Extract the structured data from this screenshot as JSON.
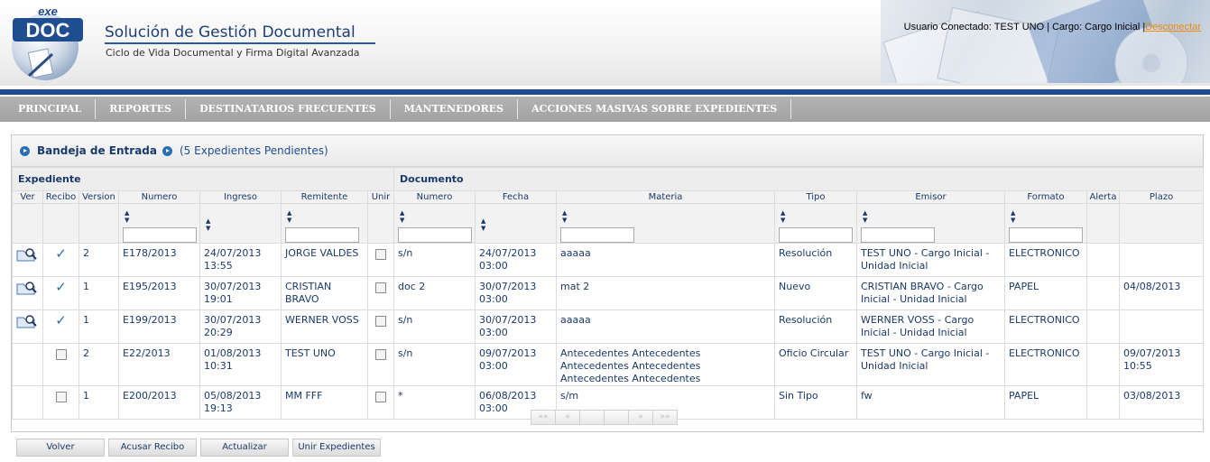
{
  "header": {
    "logo_text": "exe DOC",
    "title": "Solución de Gestión Documental",
    "subtitle": "Ciclo de Vida Documental y Firma Digital Avanzada",
    "user_info": "Usuario Conectado: TEST UNO | Cargo: Cargo Inicial |",
    "logout_label": "Desconectar",
    "accent_color": "#1f4e90",
    "link_color": "#f08a00"
  },
  "nav": {
    "items": [
      "PRINCIPAL",
      "REPORTES",
      "DESTINATARIOS FRECUENTES",
      "MANTENEDORES",
      "ACCIONES MASIVAS SOBRE EXPEDIENTES"
    ]
  },
  "inbox": {
    "title": "Bandeja de Entrada",
    "count_text": "(5 Expedientes Pendientes)",
    "group_expediente": "Expediente",
    "group_documento": "Documento",
    "columns": [
      "Ver",
      "Recibo",
      "Version",
      "Numero",
      "Ingreso",
      "Remitente",
      "Unir",
      "Numero",
      "Fecha",
      "Materia",
      "Tipo",
      "Emisor",
      "Formato",
      "Alerta",
      "Plazo"
    ],
    "rows": [
      {
        "recibo": "checked",
        "version": "2",
        "numero": "E178/2013",
        "ingreso": "24/07/2013 13:55",
        "remitente": "JORGE VALDES",
        "doc_numero": "s/n",
        "fecha": "24/07/2013 03:00",
        "materia": "aaaaa",
        "tipo": "Resolución",
        "emisor": "TEST UNO - Cargo Inicial - Unidad Inicial",
        "formato": "ELECTRONICO",
        "alerta": "",
        "plazo": ""
      },
      {
        "recibo": "checked",
        "version": "1",
        "numero": "E195/2013",
        "ingreso": "30/07/2013 19:01",
        "remitente": "CRISTIAN BRAVO",
        "doc_numero": "doc 2",
        "fecha": "30/07/2013 03:00",
        "materia": "mat 2",
        "tipo": "Nuevo",
        "emisor": "CRISTIAN BRAVO - Cargo Inicial - Unidad Inicial",
        "formato": "PAPEL",
        "alerta": "",
        "plazo": "04/08/2013"
      },
      {
        "recibo": "checked",
        "version": "1",
        "numero": "E199/2013",
        "ingreso": "30/07/2013 20:29",
        "remitente": "WERNER VOSS",
        "doc_numero": "s/n",
        "fecha": "30/07/2013 03:00",
        "materia": "aaaaa",
        "tipo": "Resolución",
        "emisor": "WERNER VOSS - Cargo Inicial - Unidad Inicial",
        "formato": "ELECTRONICO",
        "alerta": "",
        "plazo": ""
      },
      {
        "recibo": "box",
        "version": "2",
        "numero": "E22/2013",
        "ingreso": "01/08/2013 10:31",
        "remitente": "TEST UNO",
        "doc_numero": "s/n",
        "fecha": "09/07/2013 03:00",
        "materia": "Antecedentes Antecedentes Antecedentes Antecedentes Antecedentes Antecedentes",
        "tipo": "Oficio Circular",
        "emisor": "TEST UNO - Cargo Inicial - Unidad Inicial",
        "formato": "ELECTRONICO",
        "alerta": "",
        "plazo": "09/07/2013 10:55"
      },
      {
        "recibo": "box",
        "version": "1",
        "numero": "E200/2013",
        "ingreso": "05/08/2013 19:13",
        "remitente": "MM FFF",
        "doc_numero": "*",
        "fecha": "06/08/2013 03:00",
        "materia": "s/m",
        "tipo": "Sin Tipo",
        "emisor": "fw",
        "formato": "PAPEL",
        "alerta": "",
        "plazo": "03/08/2013"
      }
    ],
    "overdue_color": "#cc0000"
  },
  "pager": {
    "labels": [
      "««",
      "«",
      "",
      "",
      "»",
      "»»"
    ]
  },
  "buttons": {
    "volver": "Volver",
    "acusar": "Acusar Recibo",
    "actualizar": "Actualizar",
    "unir": "Unir Expedientes"
  }
}
